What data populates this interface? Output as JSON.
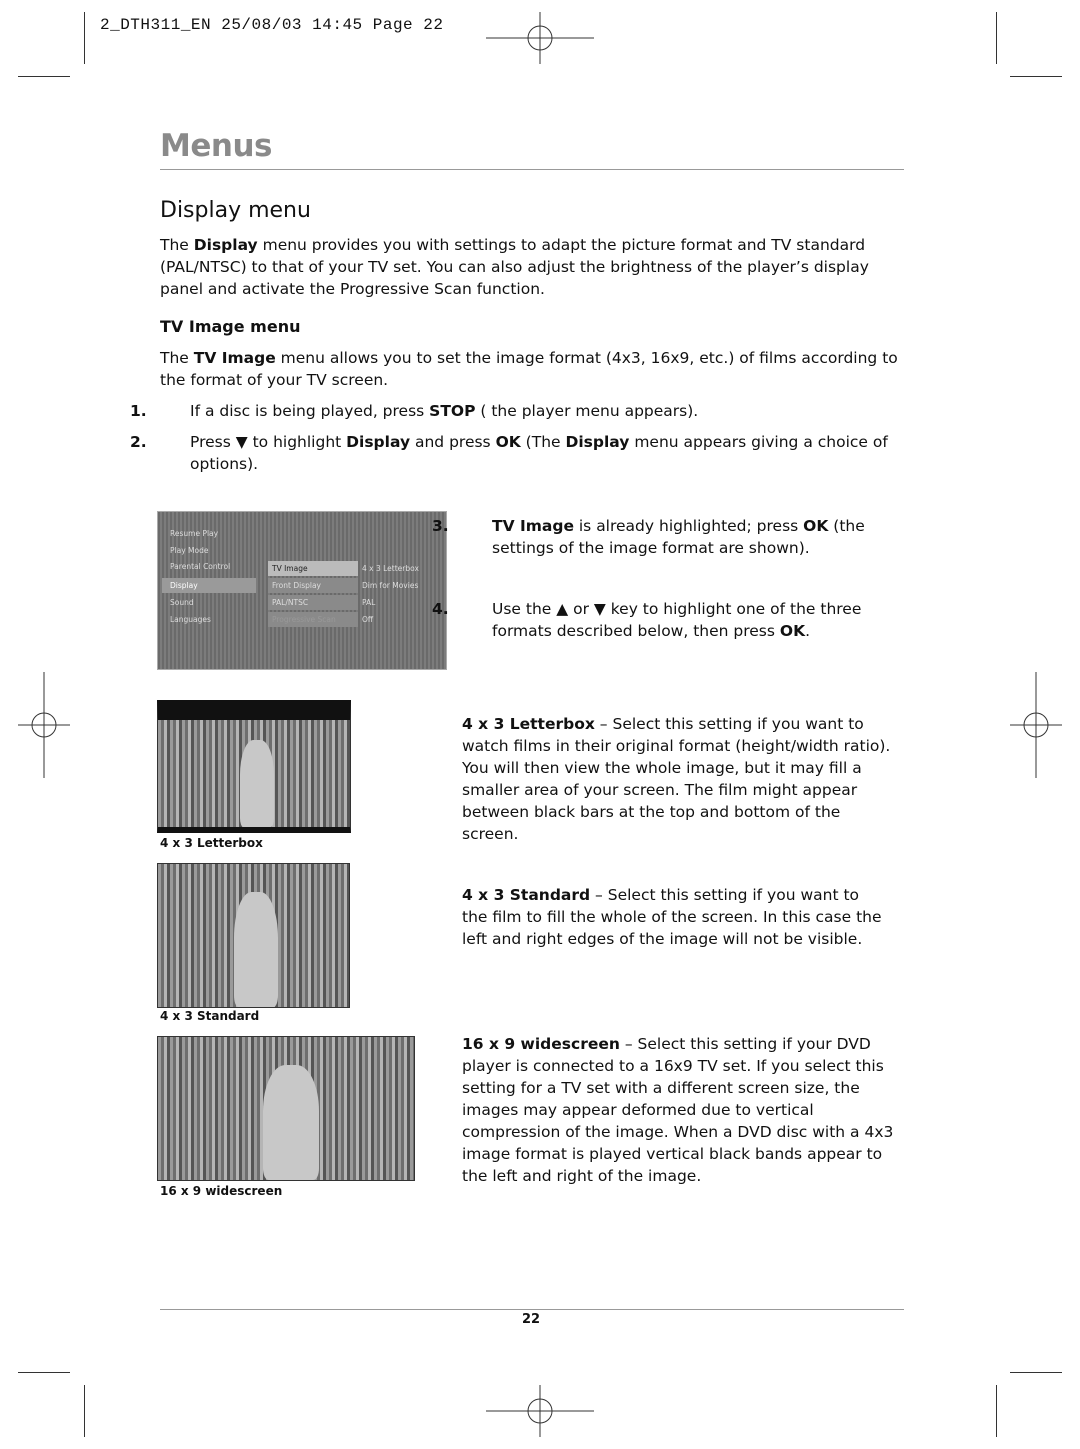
{
  "header": {
    "slug": "2_DTH311_EN  25/08/03  14:45  Page 22"
  },
  "section_title": "Menus",
  "display_menu": {
    "heading": "Display menu",
    "intro": [
      "The ",
      "Display",
      " menu provides you with settings to adapt the picture format and TV standard (PAL/NTSC) to that of your TV set. You can also adjust the brightness of the player’s display panel and activate the Progressive Scan function."
    ]
  },
  "tv_image_menu": {
    "heading": "TV Image menu",
    "intro": [
      "The ",
      "TV Image",
      " menu allows you to set the image format (4x3, 16x9, etc.) of films according to the format of your TV screen."
    ],
    "steps": [
      {
        "num": "1.",
        "parts": [
          "If a disc is being played, press ",
          "STOP",
          " ( the player menu appears)."
        ]
      },
      {
        "num": "2.",
        "parts": [
          "Press ",
          "▼",
          " to highlight ",
          "Display",
          " and press ",
          "OK",
          " (The ",
          "Display",
          " menu appears giving a choice of options)."
        ]
      },
      {
        "num": "3.",
        "parts": [
          "TV Image",
          " is already highlighted; press ",
          "OK",
          " (the settings of the image format are shown)."
        ]
      },
      {
        "num": "4.",
        "parts": [
          "Use the ",
          "▲",
          " or ",
          "▼",
          " key to highlight one of the three formats described below, then press ",
          "OK",
          "."
        ]
      }
    ]
  },
  "osd_menu": {
    "main": [
      "Resume Play",
      "Play Mode",
      "Parental Control",
      "Display",
      "Sound",
      "Languages"
    ],
    "sub": [
      "TV Image",
      "Front Display",
      "PAL/NTSC",
      "Progressive Scan"
    ],
    "values": [
      "4 x 3 Letterbox",
      "Dim for Movies",
      "PAL",
      "Off"
    ]
  },
  "formats": [
    {
      "caption": "4 x 3 Letterbox",
      "name": "4 x 3 Letterbox",
      "desc": " – Select this setting if you want to watch films in their original format (height/width ratio). You will then view the whole image, but it may fill a smaller area of your screen. The film might appear between black bars at the top and bottom of the screen."
    },
    {
      "caption": "4 x 3 Standard",
      "name": "4 x 3 Standard",
      "desc": " – Select this setting if you want to the film to fill the whole of the screen. In this case the left and right edges of the image will not be visible."
    },
    {
      "caption": "16 x 9 widescreen",
      "name": "16 x 9 widescreen",
      "desc": " – Select this setting if your DVD player is connected to a 16x9 TV set. If you select this setting for a TV set with a different screen size, the images may appear deformed due to vertical compression of the image. When a DVD disc with a 4x3 image format is played vertical black bands appear to the left and right of the image."
    }
  ],
  "footer": {
    "page_number": "22"
  }
}
